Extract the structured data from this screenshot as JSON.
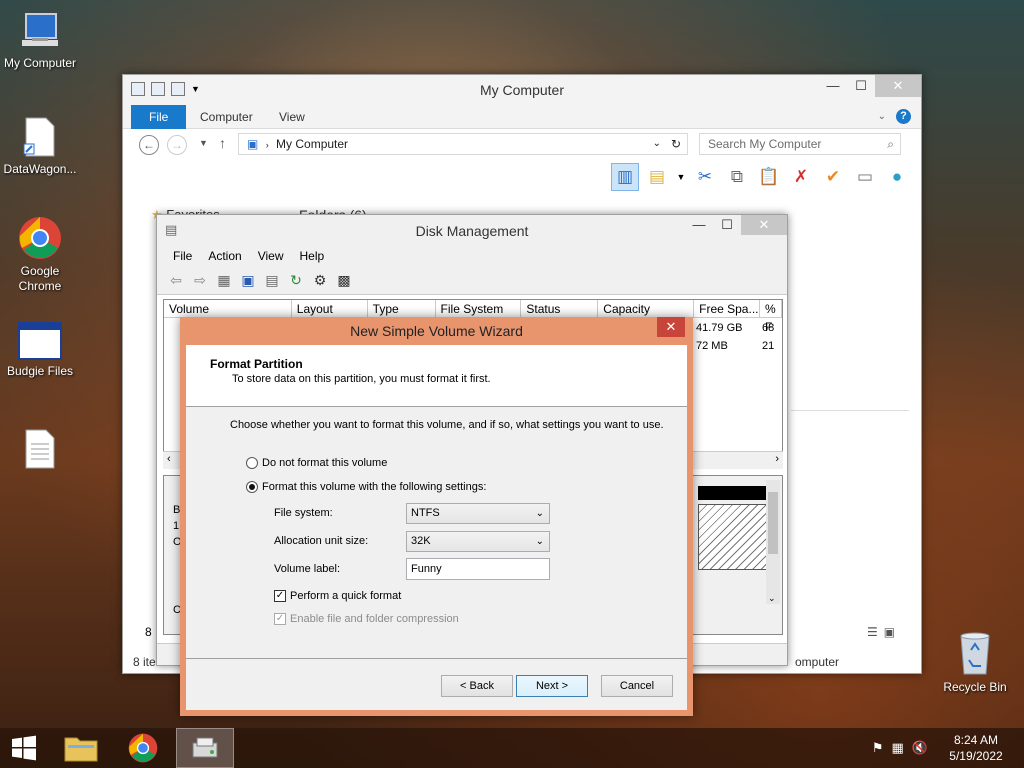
{
  "desktop": {
    "icons": [
      {
        "label": "My Computer"
      },
      {
        "label": "DataWagon..."
      },
      {
        "label": "Google Chrome"
      },
      {
        "label": "Budgie Files"
      },
      {
        "label": ""
      },
      {
        "label": "Recycle Bin"
      }
    ]
  },
  "explorer": {
    "title": "My Computer",
    "tabs": [
      "File",
      "Computer",
      "View"
    ],
    "address": "My Computer",
    "search_placeholder": "Search My Computer",
    "favorites": "Favorites",
    "folders": "Folders (6)",
    "status_items": "8 ite",
    "status_right": "omputer",
    "left_num": "8"
  },
  "disk_management": {
    "title": "Disk Management",
    "menu": [
      "File",
      "Action",
      "View",
      "Help"
    ],
    "columns": [
      "Volume",
      "Layout",
      "Type",
      "File System",
      "Status",
      "Capacity",
      "Free Spa...",
      "% F"
    ],
    "rows": [
      {
        "free": "41.79 GB",
        "pct": "68"
      },
      {
        "free": "72 MB",
        "pct": "21"
      }
    ],
    "graph_letters": [
      "B",
      "1.",
      "O",
      "C"
    ]
  },
  "wizard": {
    "title": "New Simple Volume Wizard",
    "header_title": "Format Partition",
    "header_sub": "To store data on this partition, you must format it first.",
    "intro": "Choose whether you want to format this volume, and if so, what settings you want to use.",
    "radio_no_format": "Do not format this volume",
    "radio_format": "Format this volume with the following settings:",
    "file_system_label": "File system:",
    "file_system_value": "NTFS",
    "alloc_label": "Allocation unit size:",
    "alloc_value": "32K",
    "volume_label_label": "Volume label:",
    "volume_label_value": "Funny",
    "quick_format": "Perform a quick format",
    "compression": "Enable file and folder compression",
    "back": "< Back",
    "next": "Next >",
    "cancel": "Cancel"
  },
  "taskbar": {
    "time": "8:24 AM",
    "date": "5/19/2022"
  },
  "colors": {
    "accent": "#1979ca",
    "wizard_frame": "#e8956e",
    "close_red": "#c7453a"
  }
}
